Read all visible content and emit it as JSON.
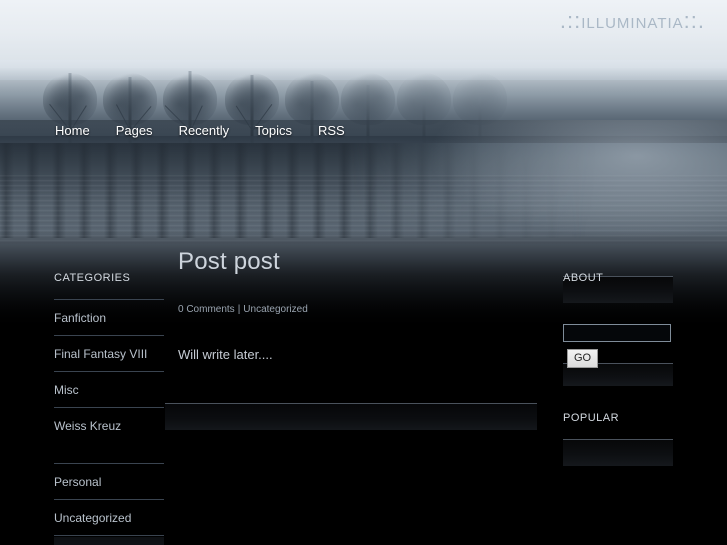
{
  "site": {
    "title": ".::Illuminatia::."
  },
  "nav": {
    "items": [
      {
        "label": "Home",
        "name": "nav-home"
      },
      {
        "label": "Pages",
        "name": "nav-pages"
      },
      {
        "label": "Recently",
        "name": "nav-recently"
      },
      {
        "label": "Topics",
        "name": "nav-topics"
      },
      {
        "label": "RSS",
        "name": "nav-rss"
      }
    ]
  },
  "left_sidebar": {
    "heading": "Categories",
    "categories": [
      "Fanfiction",
      "Final Fantasy VIII",
      "Misc",
      "Weiss Kreuz"
    ],
    "categories_secondary": [
      "Personal",
      "Uncategorized"
    ]
  },
  "main": {
    "post": {
      "title": "Post post",
      "comments": "0 Comments",
      "separator": "|",
      "category": "Uncategorized",
      "body": "Will write later...."
    }
  },
  "right_sidebar": {
    "about_heading": "About",
    "search": {
      "value": "",
      "placeholder": "",
      "button_label": "GO"
    },
    "popular_heading": "Popular"
  },
  "colors": {
    "page_background": "#000000",
    "sky": "#eef2f6",
    "water": "#5d6a77",
    "text_primary": "#c8ced6",
    "text_muted": "#9aa4b0",
    "rule": "#4a525c",
    "nav_text": "#ffffff",
    "button_face": "#e8e8e8"
  }
}
